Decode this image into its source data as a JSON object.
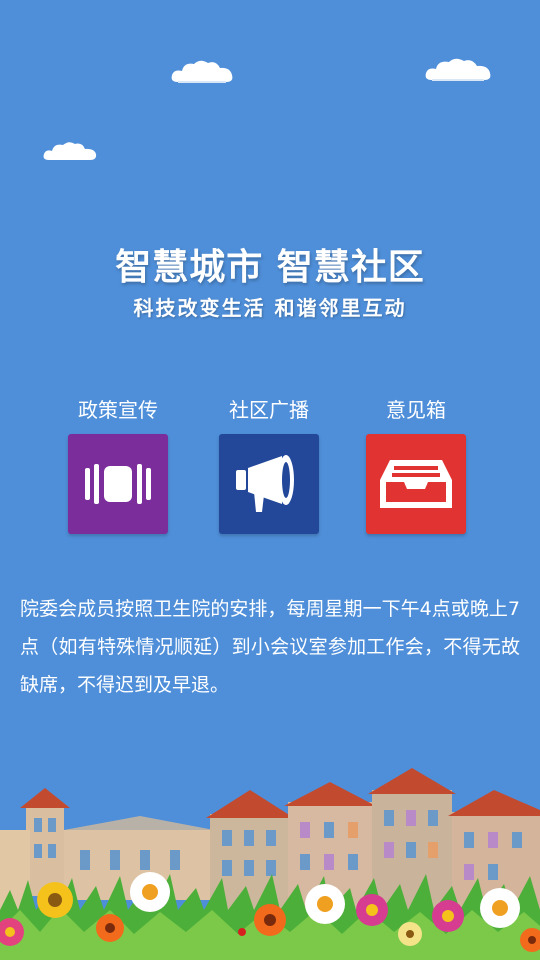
{
  "header": {
    "title": "智慧城市 智慧社区",
    "subtitle": "科技改变生活 和谐邻里互动"
  },
  "menu": {
    "items": [
      {
        "label": "政策宣传",
        "icon": "policy-icon",
        "color": "#7b2d9c"
      },
      {
        "label": "社区广播",
        "icon": "megaphone-icon",
        "color": "#23489a"
      },
      {
        "label": "意见箱",
        "icon": "inbox-icon",
        "color": "#e23333"
      }
    ]
  },
  "notice": {
    "text": "院委会成员按照卫生院的安排，每周星期一下午4点或晚上7点（如有特殊情况顺延）到小会议室参加工作会，不得无故缺席，不得迟到及早退。"
  },
  "colors": {
    "background": "#4f8fd9",
    "text": "#ffffff"
  }
}
